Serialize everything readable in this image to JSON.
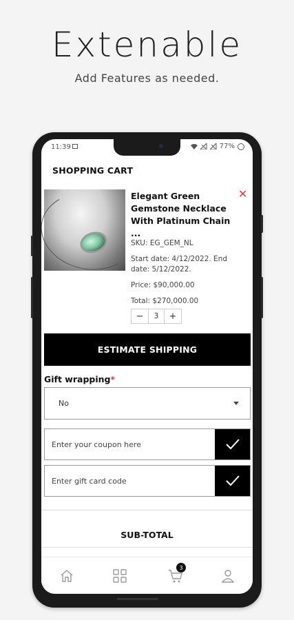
{
  "promo": {
    "headline": "Extenable",
    "subline": "Add Features as needed."
  },
  "status_bar": {
    "time": "11:39",
    "battery": "77%"
  },
  "cart": {
    "title": "SHOPPING CART",
    "product": {
      "name": "Elegant Green Gemstone Necklace With Platinum Chain ...",
      "sku": "SKU: EG_GEM_NL",
      "dates": "Start date: 4/12/2022. End date: 5/12/2022.",
      "price": "Price: $90,000.00",
      "total": "Total: $270,000.00",
      "quantity": "3",
      "remove_icon": "close-icon"
    },
    "estimate_shipping_label": "ESTIMATE SHIPPING",
    "gift_wrapping": {
      "label": "Gift wrapping",
      "required_mark": "*",
      "selected": "No"
    },
    "coupon": {
      "placeholder": "Enter your coupon here",
      "button_icon": "checkmark-icon"
    },
    "gift_card": {
      "placeholder": "Enter gift card code",
      "button_icon": "checkmark-icon"
    },
    "subtotal_label": "SUB-TOTAL"
  },
  "tabbar": {
    "items": [
      {
        "name": "home",
        "icon": "home-icon"
      },
      {
        "name": "categories",
        "icon": "grid-icon"
      },
      {
        "name": "cart",
        "icon": "cart-icon",
        "badge": "3"
      },
      {
        "name": "account",
        "icon": "user-icon"
      }
    ]
  },
  "colors": {
    "accent": "#000000",
    "remove": "#e53935",
    "required": "#e53935",
    "background": "#f4f4f4"
  }
}
